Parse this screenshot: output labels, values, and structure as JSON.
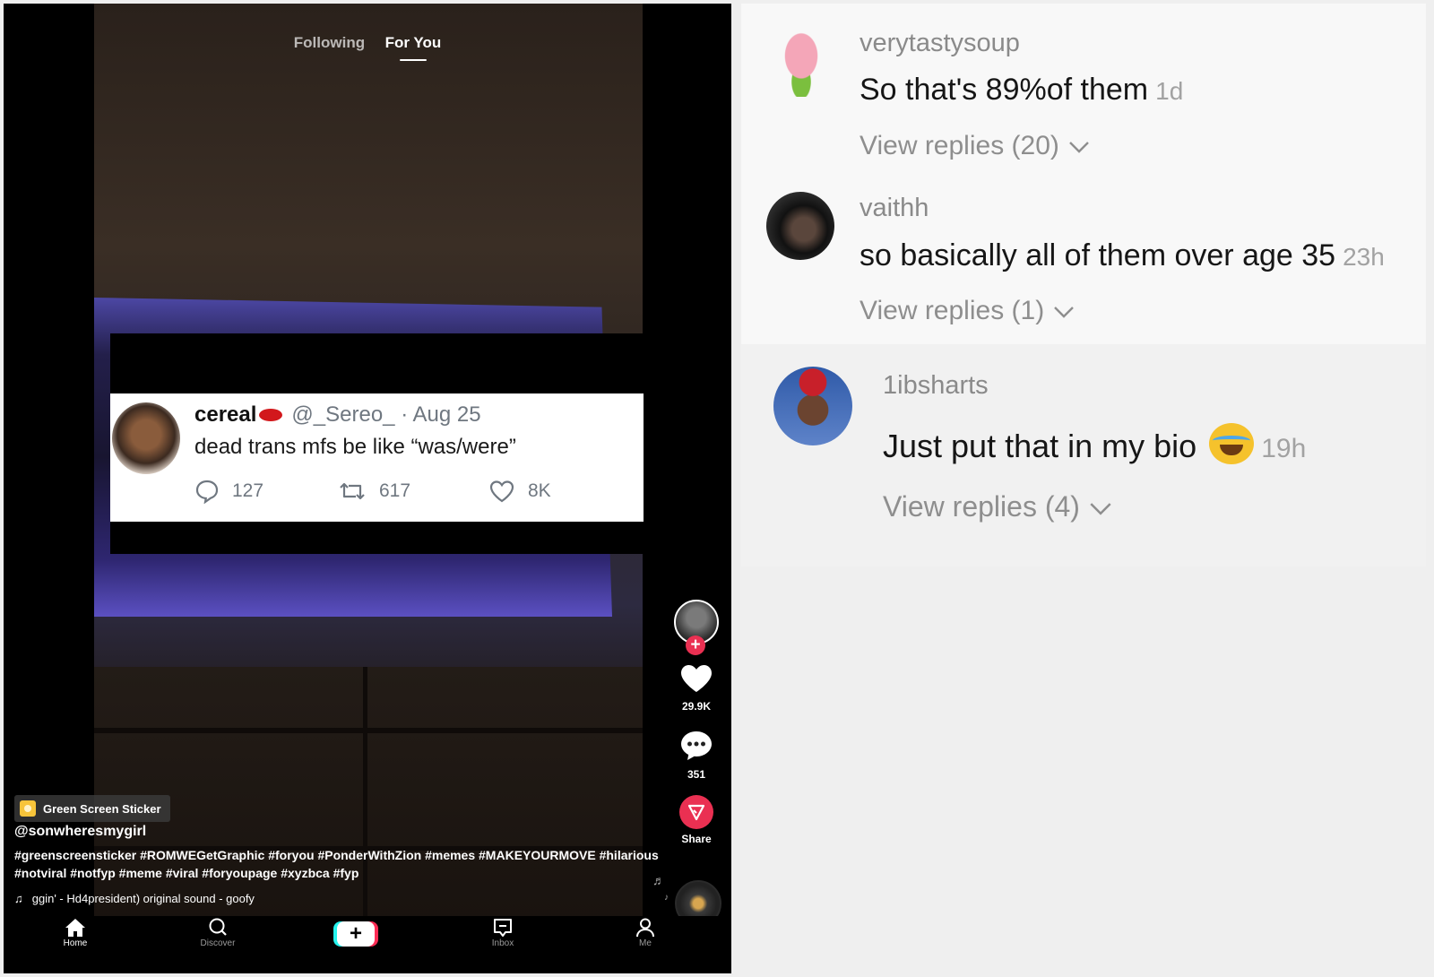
{
  "feed_tabs": {
    "following": "Following",
    "for_you": "For You"
  },
  "tweet": {
    "name": "cereal",
    "handle": "@_Sereo_",
    "separator": "·",
    "date": "Aug 25",
    "text": "dead trans mfs be like “was/were”",
    "replies": "127",
    "retweets": "617",
    "likes": "8K"
  },
  "actions": {
    "likes": "29.9K",
    "comments": "351",
    "share_label": "Share"
  },
  "caption": {
    "badge": "Green Screen Sticker",
    "handle": "@sonwheresmygirl",
    "hashtags": "#greenscreensticker #ROMWEGetGraphic #foryou #PonderWithZion #memes #MAKEYOURMOVE #hilarious #notviral #notfyp #meme #viral #foryoupage #xyzbca #fyp",
    "sound": "ggin' - Hd4president)    original sound - goofy"
  },
  "nav": {
    "home": "Home",
    "discover": "Discover",
    "create": "+",
    "inbox": "Inbox",
    "me": "Me"
  },
  "comments": [
    {
      "user": "verytastysoup",
      "text": "So that's 89%of them",
      "time": "1d",
      "replies": "View replies (20)"
    },
    {
      "user": "vaithh",
      "text": "so basically all of them over age 35",
      "time": "23h",
      "replies": "View replies (1)"
    },
    {
      "user": "1ibsharts",
      "text": "Just put that in my bio",
      "time": "19h",
      "replies": "View replies (4)"
    }
  ],
  "colors": {
    "accent": "#ea3052",
    "comment_bg": "#f8f8f8",
    "page_bg": "#efefef"
  }
}
